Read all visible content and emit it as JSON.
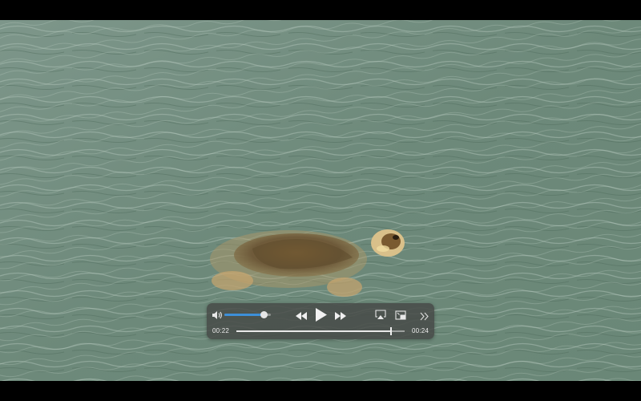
{
  "player": {
    "elapsed": "00:22",
    "total": "00:24",
    "progress_fraction": 0.917,
    "volume_fraction": 0.85
  },
  "icons": {
    "volume": "speaker-icon",
    "rewind": "rewind-icon",
    "play": "play-icon",
    "fast_forward": "fast-forward-icon",
    "airplay": "airplay-icon",
    "picture_in_picture": "pip-icon",
    "more": "chevron-double-right-icon"
  },
  "colors": {
    "water": "#6f8b7c",
    "volume_accent": "#3d8fd8",
    "controls_bg": "#464846"
  }
}
